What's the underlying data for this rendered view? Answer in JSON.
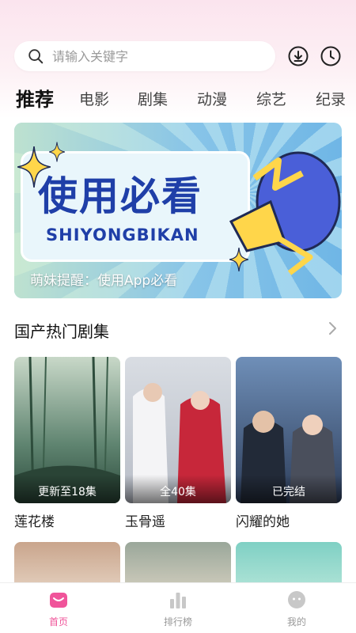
{
  "search": {
    "placeholder": "请输入关键字"
  },
  "header_icons": [
    "download-icon",
    "history-clock-icon"
  ],
  "tabs": [
    {
      "label": "推荐",
      "active": true
    },
    {
      "label": "电影"
    },
    {
      "label": "剧集"
    },
    {
      "label": "动漫"
    },
    {
      "label": "综艺"
    },
    {
      "label": "纪录"
    }
  ],
  "banner": {
    "title": "使用必看",
    "subtitle": "SHIYONGBIKAN",
    "caption": "萌妹提醒：使用App必看"
  },
  "section": {
    "title": "国产热门剧集",
    "more_icon": "chevron-right-icon"
  },
  "posters": [
    {
      "title": "莲花楼",
      "badge": "更新至18集"
    },
    {
      "title": "玉骨遥",
      "badge": "全40集"
    },
    {
      "title": "闪耀的她",
      "badge": "已完结"
    }
  ],
  "bottom_nav": [
    {
      "label": "首页",
      "icon": "home-icon",
      "active": true
    },
    {
      "label": "排行榜",
      "icon": "ranking-chart-icon"
    },
    {
      "label": "我的",
      "icon": "profile-face-icon"
    }
  ],
  "colors": {
    "accent": "#f0549a",
    "banner_blue": "#1f3fa8"
  }
}
